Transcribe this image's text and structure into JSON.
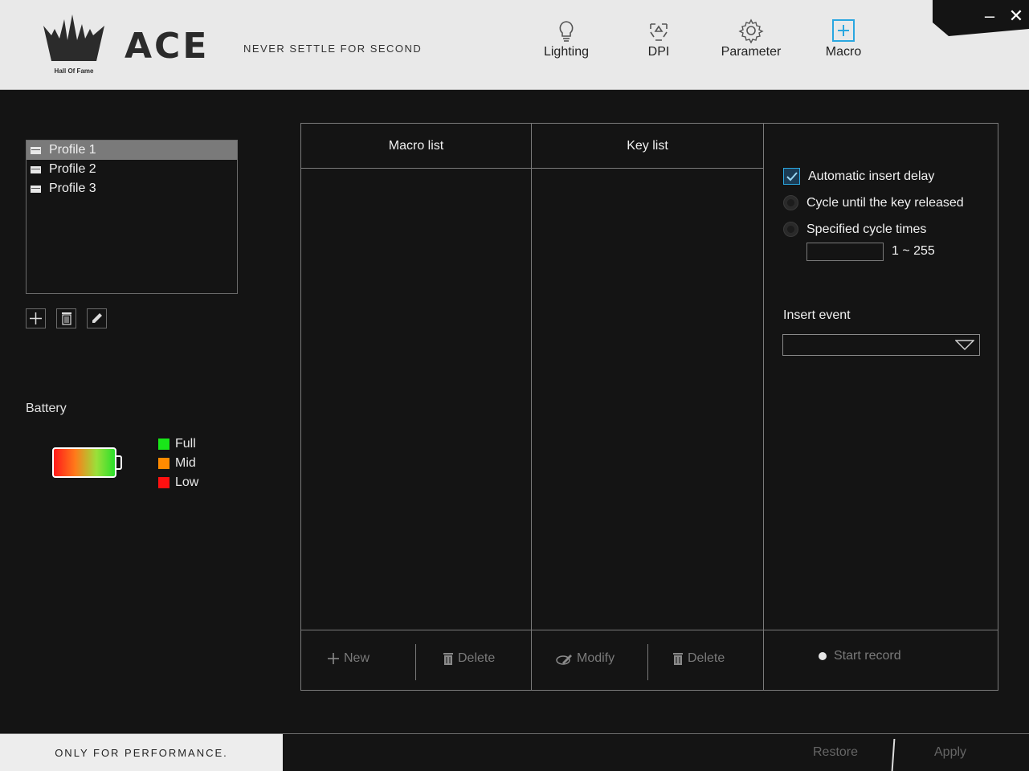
{
  "brand": {
    "logo_text": "Hall Of Fame",
    "name": "ACE",
    "tagline": "NEVER SETTLE FOR SECOND"
  },
  "nav": {
    "lighting": "Lighting",
    "dpi": "DPI",
    "parameter": "Parameter",
    "macro": "Macro",
    "active": "macro",
    "active_color": "#2aa7e0"
  },
  "window": {
    "minimize": "–",
    "close": "✕"
  },
  "profiles": {
    "items": [
      "Profile 1",
      "Profile 2",
      "Profile 3"
    ],
    "selected_index": 0
  },
  "battery": {
    "label": "Battery",
    "legend": [
      {
        "label": "Full",
        "color": "#19e619"
      },
      {
        "label": "Mid",
        "color": "#ff8a00"
      },
      {
        "label": "Low",
        "color": "#ff1010"
      }
    ]
  },
  "macro": {
    "macro_list_header": "Macro list",
    "key_list_header": "Key list",
    "new_label": "New",
    "delete_label": "Delete",
    "modify_label": "Modify",
    "key_delete_label": "Delete",
    "start_record_label": "Start record"
  },
  "options": {
    "auto_insert_delay": "Automatic insert delay",
    "auto_insert_delay_checked": true,
    "cycle_until_released": "Cycle until the key released",
    "specified_cycle_times": "Specified cycle times",
    "cycle_value": "",
    "cycle_range": "1 ~ 255",
    "insert_event_label": "Insert event",
    "insert_event_value": ""
  },
  "footer": {
    "tagline": "ONLY FOR PERFORMANCE.",
    "restore": "Restore",
    "apply": "Apply"
  }
}
